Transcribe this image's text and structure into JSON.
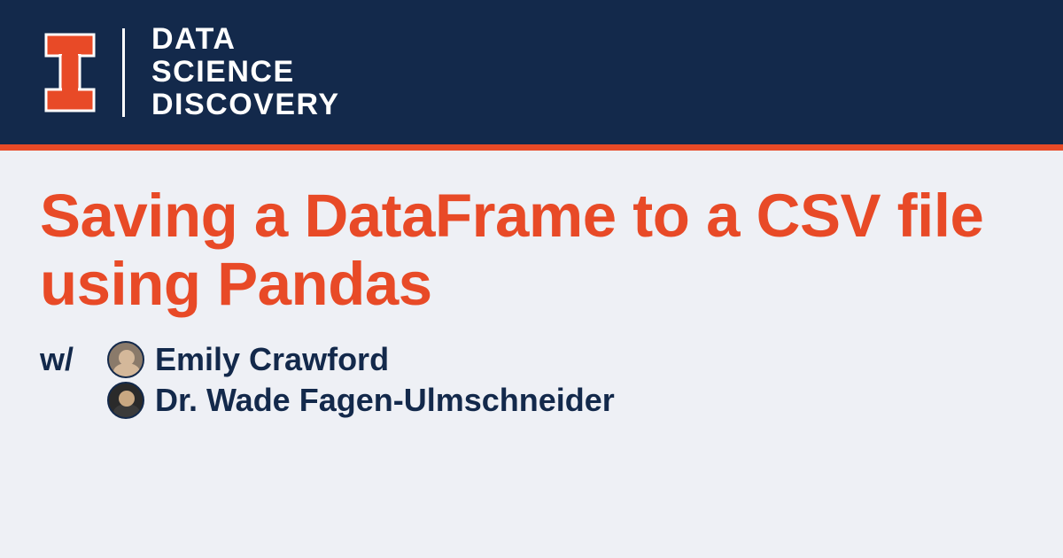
{
  "header": {
    "site_title_line1": "DATA",
    "site_title_line2": "SCIENCE",
    "site_title_line3": "DISCOVERY"
  },
  "content": {
    "title": "Saving a DataFrame to a CSV file using Pandas",
    "with_prefix": "w/",
    "authors": [
      {
        "name": "Emily Crawford"
      },
      {
        "name": "Dr. Wade Fagen-Ulmschneider"
      }
    ]
  },
  "colors": {
    "navy": "#13294b",
    "orange": "#e84a27",
    "background": "#eef0f5"
  }
}
